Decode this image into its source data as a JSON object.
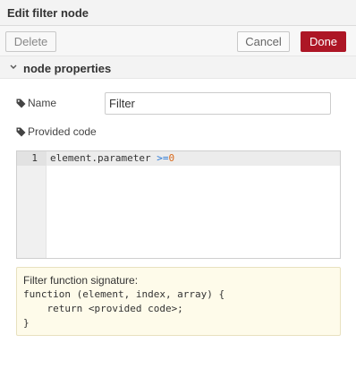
{
  "dialog": {
    "title": "Edit filter node"
  },
  "toolbar": {
    "delete_label": "Delete",
    "cancel_label": "Cancel",
    "done_label": "Done"
  },
  "section": {
    "label": "node properties"
  },
  "fields": {
    "name": {
      "label": "Name",
      "value": "Filter"
    },
    "code": {
      "label": "Provided code"
    }
  },
  "editor": {
    "line_number": "1",
    "code_prefix": "element.parameter ",
    "code_operator": ">=",
    "code_number": "0"
  },
  "help": {
    "line1": "Filter function signature:",
    "line2": "function (element, index, array) {",
    "line3": "    return <provided code>;",
    "line4": "}"
  },
  "colors": {
    "done_bg": "#ad1625",
    "help_bg": "#fefbea"
  },
  "icons": {
    "tag": "tag-icon",
    "chevron": "chevron-down-icon"
  }
}
